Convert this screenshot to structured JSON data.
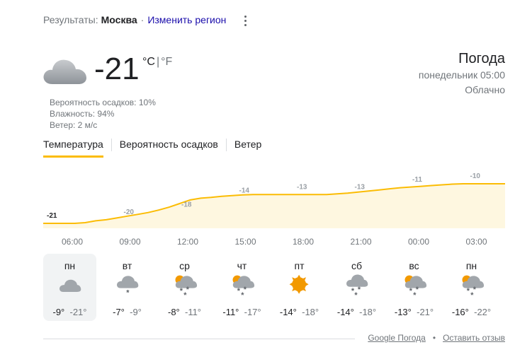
{
  "results": {
    "prefix": "Результаты:",
    "city": "Москва",
    "dot": "·",
    "change_region": "Изменить регион"
  },
  "current": {
    "icon": "cloud-icon",
    "temperature": "-21",
    "unit_c": "°C",
    "unit_sep": "|",
    "unit_f": "°F",
    "precip": "Вероятность осадков: 10%",
    "humidity": "Влажность: 94%",
    "wind": "Ветер: 2 м/с"
  },
  "header": {
    "title": "Погода",
    "datetime": "понедельник 05:00",
    "condition": "Облачно"
  },
  "tabs": [
    "Температура",
    "Вероятность осадков",
    "Ветер"
  ],
  "active_tab": 0,
  "chart_data": {
    "type": "area",
    "x": [
      "06:00",
      "09:00",
      "12:00",
      "15:00",
      "18:00",
      "21:00",
      "00:00",
      "03:00"
    ],
    "series": [
      {
        "values": [
          -21,
          -20,
          -18,
          -14,
          -13,
          -13,
          -11,
          -10
        ]
      }
    ],
    "data_labels": [
      "-21",
      "-20",
      "-18",
      "-14",
      "-13",
      "-13",
      "-11",
      "-10"
    ],
    "curve": [
      -21,
      -21,
      -21,
      -21,
      -20.8,
      -20.3,
      -20,
      -19.5,
      -19,
      -18.5,
      -18,
      -17.3,
      -16.5,
      -15.5,
      -14.5,
      -14,
      -13.8,
      -13.5,
      -13.3,
      -13.1,
      -13,
      -13,
      -13,
      -13,
      -13,
      -13,
      -13,
      -13,
      -12.8,
      -12.6,
      -12.3,
      -12,
      -11.7,
      -11.4,
      -11.1,
      -10.9,
      -10.7,
      -10.5,
      -10.3,
      -10.1,
      -10,
      -10,
      -10,
      -10,
      -10
    ],
    "fill_color": "#fef7e0",
    "line_color": "#fbbc04"
  },
  "days": [
    {
      "name": "пн",
      "icon": "cloudy-icon",
      "hi": "-9°",
      "lo": "-21°"
    },
    {
      "name": "вт",
      "icon": "light-snow-icon",
      "hi": "-7°",
      "lo": "-9°"
    },
    {
      "name": "ср",
      "icon": "partly-cloudy-snow-icon",
      "hi": "-8°",
      "lo": "-11°"
    },
    {
      "name": "чт",
      "icon": "partly-cloudy-snow-icon",
      "hi": "-11°",
      "lo": "-17°"
    },
    {
      "name": "пт",
      "icon": "sunny-icon",
      "hi": "-14°",
      "lo": "-18°"
    },
    {
      "name": "сб",
      "icon": "snow-icon",
      "hi": "-14°",
      "lo": "-18°"
    },
    {
      "name": "вс",
      "icon": "partly-cloudy-snow-icon",
      "hi": "-13°",
      "lo": "-21°"
    },
    {
      "name": "пн",
      "icon": "partly-cloudy-snow-icon",
      "hi": "-16°",
      "lo": "-22°"
    }
  ],
  "active_day": 0,
  "footer": {
    "source": "Google Погода",
    "bullet": "•",
    "feedback": "Оставить отзыв"
  },
  "colors": {
    "accent": "#fbbc04",
    "link": "#1a0dab",
    "cloud": "#9aa0a6",
    "sun": "#f29900"
  }
}
